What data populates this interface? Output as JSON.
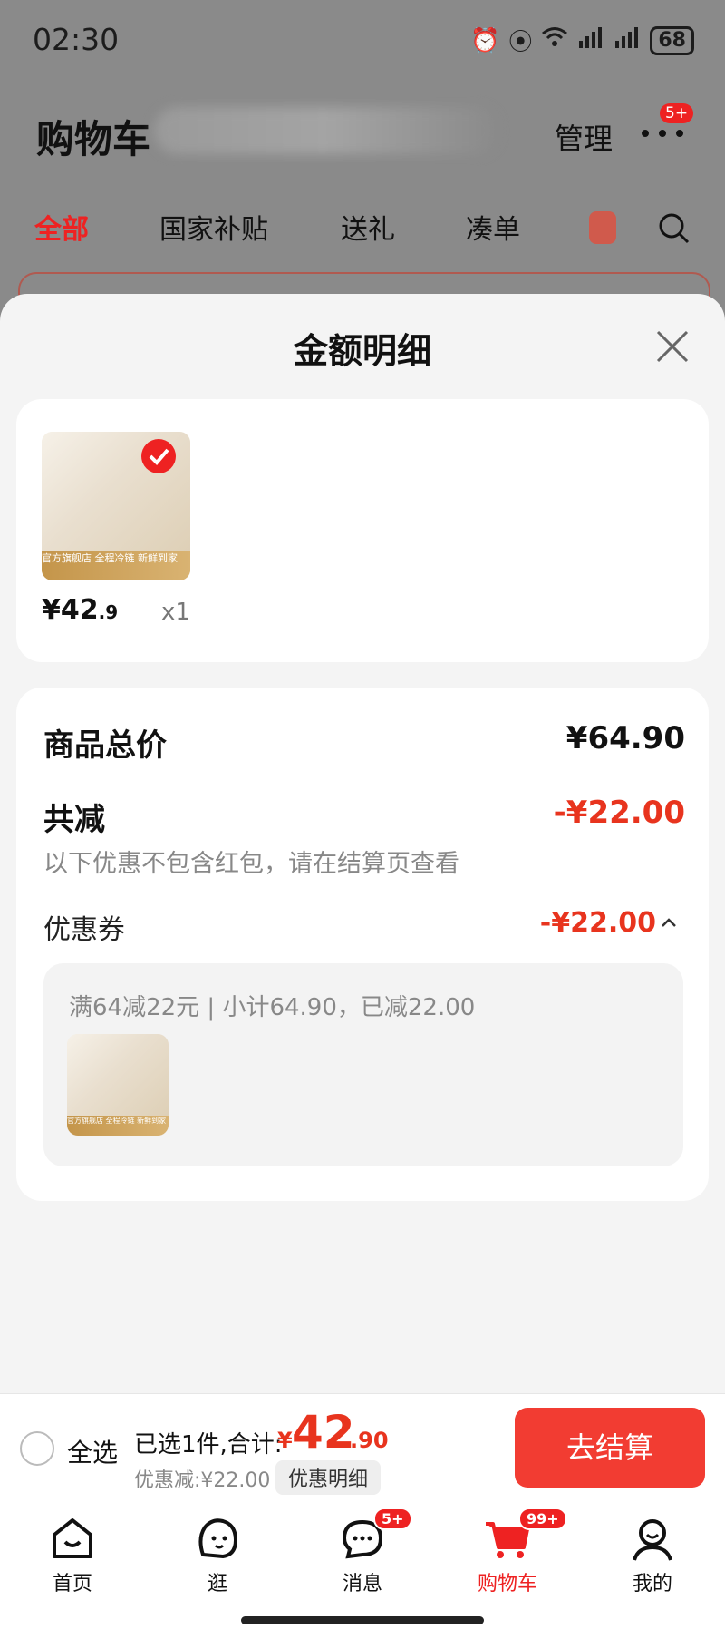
{
  "status_bar": {
    "time": "02:30",
    "battery": "68"
  },
  "cart_header": {
    "title": "购物车",
    "manage": "管理",
    "more_badge": "5+"
  },
  "tabs": [
    {
      "label": "全部"
    },
    {
      "label": "国家补贴"
    },
    {
      "label": "送礼"
    },
    {
      "label": "凑单"
    }
  ],
  "sheet": {
    "title": "金额明细",
    "item": {
      "price_main": "¥42",
      "price_decimal": ".9",
      "qty": "x1",
      "store_tag": "官方旗舰店 全程冷链 新鲜到家"
    },
    "total_label": "商品总价",
    "total_value": "¥64.90",
    "reduce_label": "共减",
    "reduce_value": "-¥22.00",
    "reduce_note": "以下优惠不包含红包，请在结算页查看",
    "coupon_label": "优惠券",
    "coupon_value": "-¥22.00",
    "coupon_desc": "满64减22元 | 小计64.90，已减22.00"
  },
  "bottom_bar": {
    "select_all": "全选",
    "selected_text": "已选1件,合计:",
    "sum_currency": "¥",
    "sum_integer": "42",
    "sum_decimal": ".90",
    "discount_text": "优惠减:¥22.00",
    "detail_button": "优惠明细",
    "checkout_button": "去结算"
  },
  "nav": [
    {
      "label": "首页"
    },
    {
      "label": "逛"
    },
    {
      "label": "消息",
      "badge": "5+"
    },
    {
      "label": "购物车",
      "badge": "99+"
    },
    {
      "label": "我的"
    }
  ],
  "colors": {
    "accent_red": "#e8341e",
    "checkout_red": "#f23c32"
  }
}
